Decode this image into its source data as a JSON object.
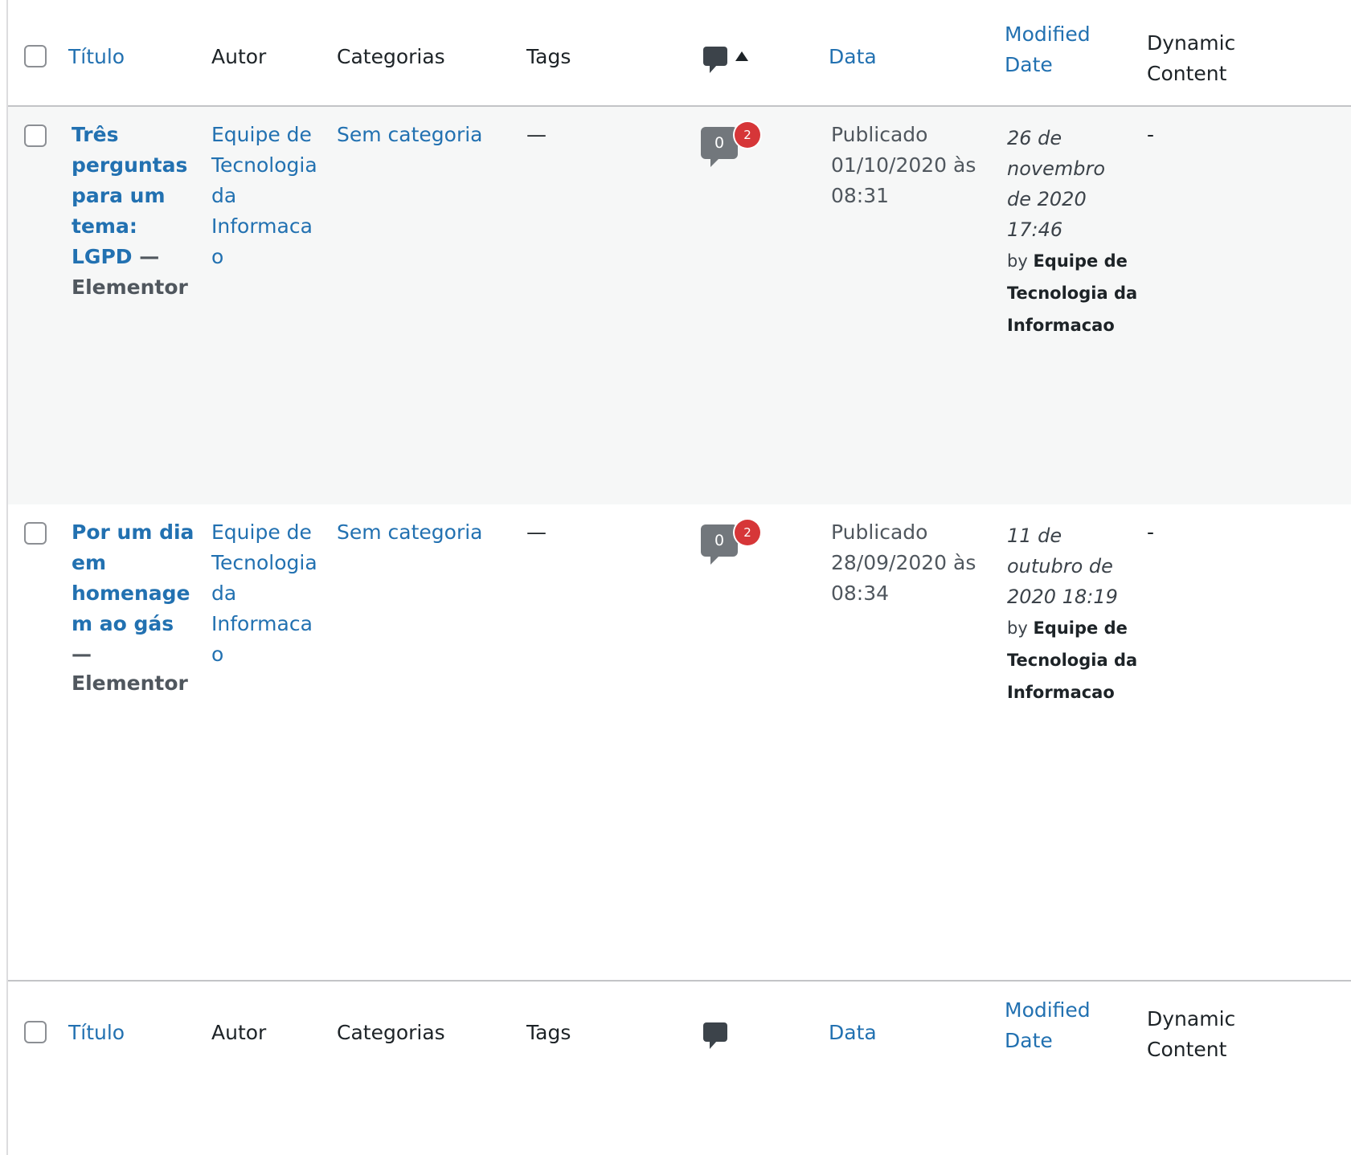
{
  "columns": {
    "title": "Título",
    "author": "Autor",
    "categories": "Categorias",
    "tags": "Tags",
    "comments_icon": "comment-icon",
    "date": "Data",
    "modified_date_line1": "Modified",
    "modified_date_line2": "Date",
    "dynamic_line1": "Dynamic",
    "dynamic_line2": "Content"
  },
  "rows": [
    {
      "title_lines": [
        "Três",
        "perguntas",
        "para um",
        "tema:",
        "LGPD"
      ],
      "title_suffix_inline": "—",
      "title_suffix_line": "Elementor",
      "author_lines": [
        "Equipe de",
        "Tecnologia",
        "da",
        "Informaca",
        "o"
      ],
      "category": "Sem categoria",
      "tags": "—",
      "comments_approved": "0",
      "comments_pending": "2",
      "date_status": "Publicado",
      "date_value": "01/10/2020 às",
      "date_time": "08:31",
      "modified_lines": [
        "26 de",
        "novembro",
        "de 2020",
        "17:46"
      ],
      "modified_by_prefix": "by",
      "modified_by_lines": [
        "Equipe de",
        "Tecnologia da",
        "Informacao"
      ],
      "dynamic": "-"
    },
    {
      "title_lines": [
        "Por um dia",
        "em",
        "homenage",
        "m ao gás"
      ],
      "title_suffix_dash": "—",
      "title_suffix_line": "Elementor",
      "author_lines": [
        "Equipe de",
        "Tecnologia",
        "da",
        "Informaca",
        "o"
      ],
      "category": "Sem categoria",
      "tags": "—",
      "comments_approved": "0",
      "comments_pending": "2",
      "date_status": "Publicado",
      "date_value": "28/09/2020 às",
      "date_time": "08:34",
      "modified_lines": [
        "11 de",
        "outubro de",
        "2020 18:19"
      ],
      "modified_by_prefix": "by",
      "modified_by_lines": [
        "Equipe de",
        "Tecnologia da",
        "Informacao"
      ],
      "dynamic": "-"
    }
  ],
  "colors": {
    "link": "#2271b1",
    "badge": "#d63638",
    "bubble": "#72777c",
    "stripe": "#f6f7f7"
  }
}
